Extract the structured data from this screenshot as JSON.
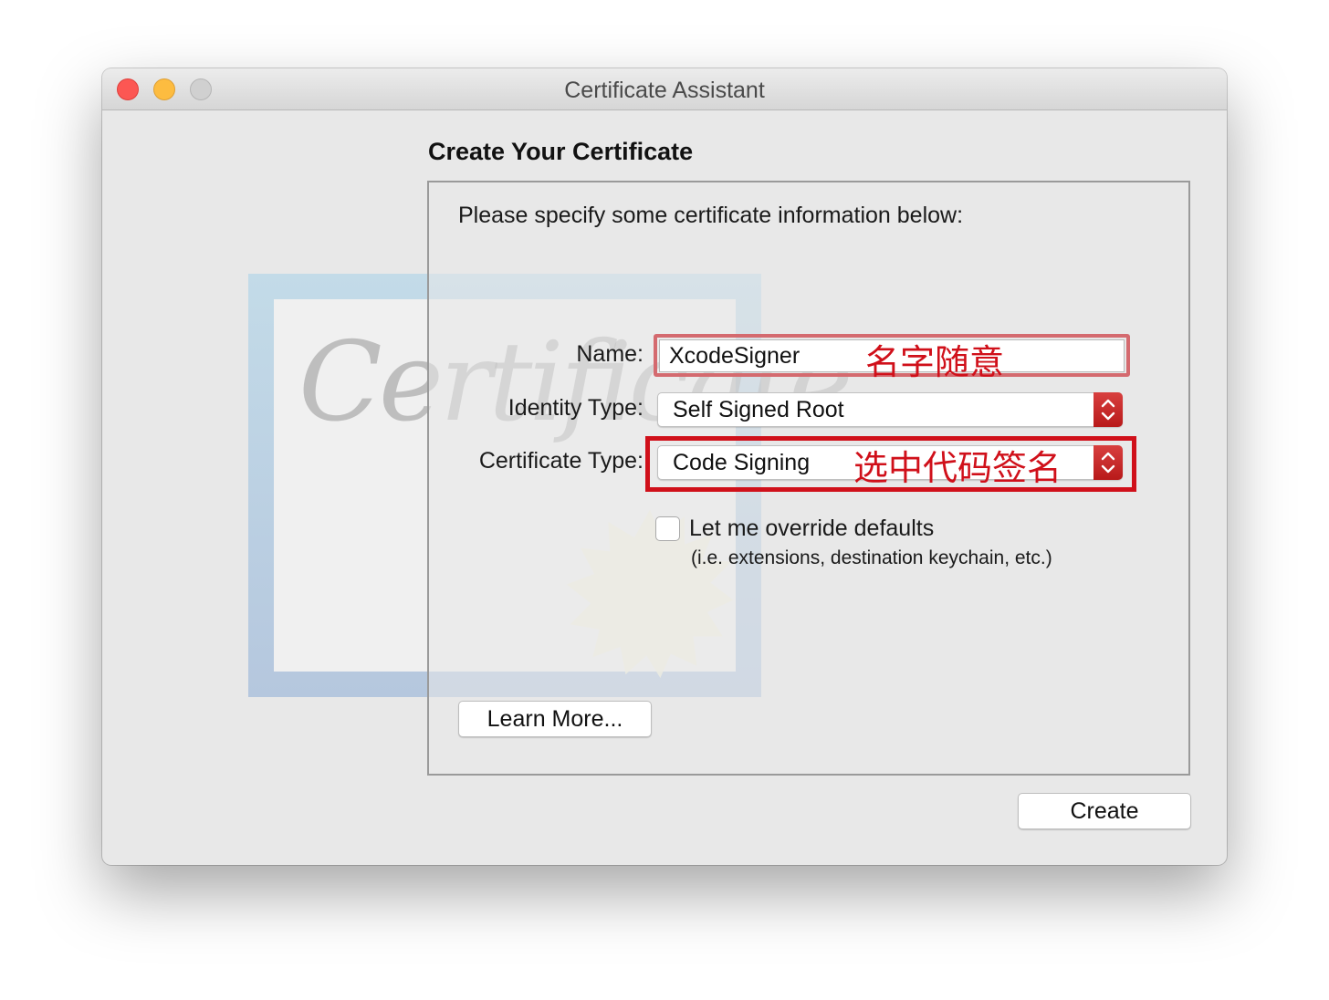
{
  "window": {
    "title": "Certificate Assistant"
  },
  "page": {
    "heading": "Create Your Certificate",
    "instructions": "Please specify some certificate information below:"
  },
  "illustration": {
    "script_text": "Certificate"
  },
  "form": {
    "name_label": "Name:",
    "name_value": "XcodeSigner",
    "identity_type_label": "Identity Type:",
    "identity_type_value": "Self Signed Root",
    "certificate_type_label": "Certificate Type:",
    "certificate_type_value": "Code Signing",
    "override_label": "Let me override defaults",
    "override_sublabel": "(i.e. extensions, destination keychain, etc.)",
    "override_checked": false
  },
  "annotations": {
    "name_note": "名字随意",
    "certificate_type_note": "选中代码签名",
    "color": "#d0101a"
  },
  "buttons": {
    "learn_more": "Learn More...",
    "create": "Create"
  },
  "colors": {
    "close": "#fc5753",
    "minimize": "#fdbc40",
    "zoom_inactive": "#d0d0d0",
    "popup_accent": "#c82828"
  }
}
